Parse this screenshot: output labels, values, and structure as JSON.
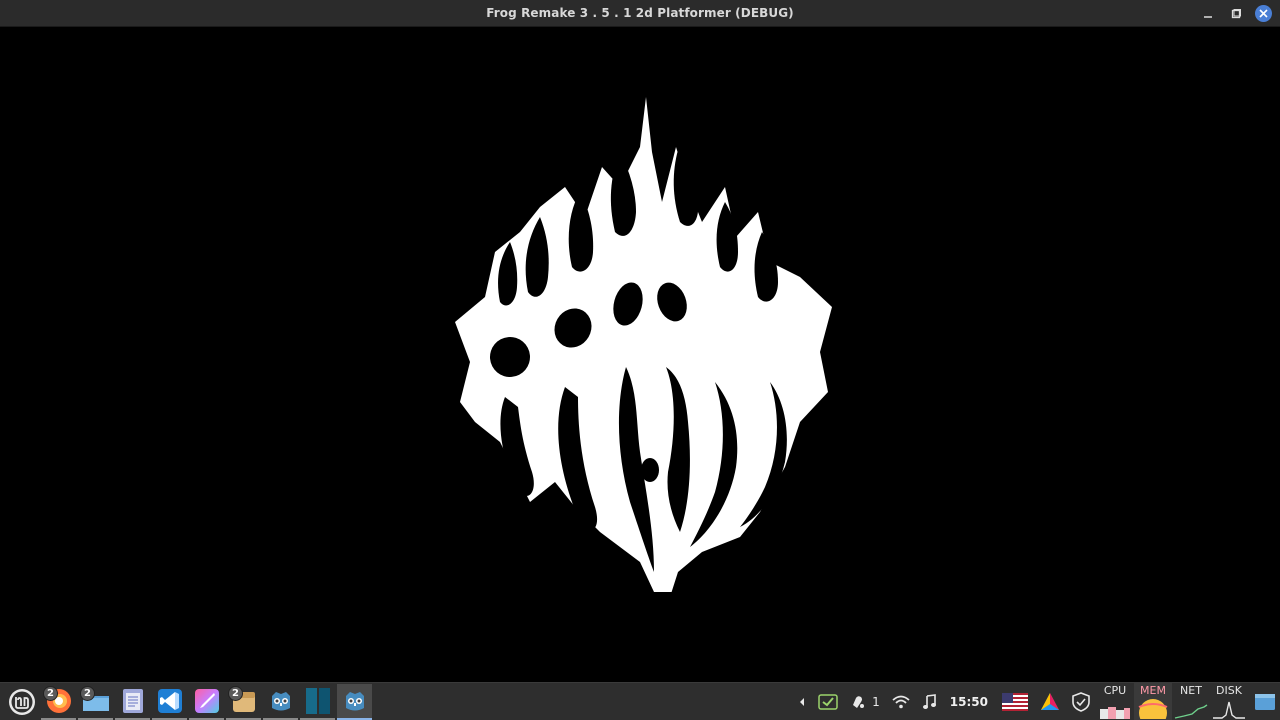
{
  "window": {
    "title": "Frog Remake 3 . 5 . 1 2d Platformer (DEBUG)",
    "controls": [
      "minimize-icon",
      "maximize-icon",
      "close-icon"
    ]
  },
  "taskbar": {
    "apps": [
      {
        "name": "mint-menu",
        "icon": "mint-logo-icon",
        "badge": ""
      },
      {
        "name": "firefox",
        "icon": "firefox-icon",
        "badge": "2"
      },
      {
        "name": "files",
        "icon": "folder-icon",
        "badge": "2"
      },
      {
        "name": "text-editor",
        "icon": "document-icon",
        "badge": ""
      },
      {
        "name": "vscode",
        "icon": "vscode-icon",
        "badge": ""
      },
      {
        "name": "krita",
        "icon": "paintbrush-icon",
        "badge": ""
      },
      {
        "name": "archive",
        "icon": "archive-icon",
        "badge": "2"
      },
      {
        "name": "godot",
        "icon": "godot-icon",
        "badge": ""
      },
      {
        "name": "terminal",
        "icon": "window-icon",
        "badge": ""
      },
      {
        "name": "godot-game",
        "icon": "godot-icon",
        "badge": ""
      }
    ],
    "tray": {
      "notifications_count": "1",
      "clock": "15:50",
      "keyboard_layout": "us-flag-icon"
    },
    "monitors": {
      "cpu_label": "CPU",
      "mem_label": "MEM",
      "net_label": "NET",
      "disk_label": "DISK"
    }
  },
  "colors": {
    "titlebar_bg": "#2b2b2b",
    "taskbar_bg": "#2e2e2e",
    "close_button": "#4a7fd6",
    "viewport_bg": "#000000"
  }
}
